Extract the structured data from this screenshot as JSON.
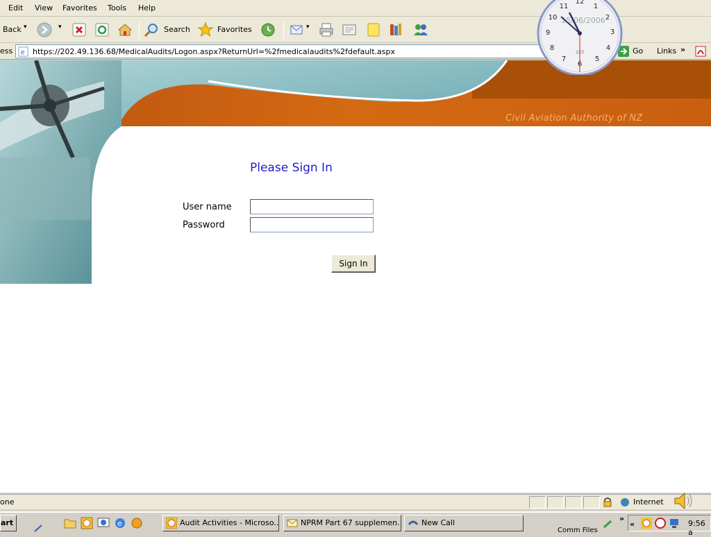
{
  "menu": {
    "items": [
      "Edit",
      "View",
      "Favorites",
      "Tools",
      "Help"
    ]
  },
  "toolbar": {
    "back_label": "Back",
    "search_label": "Search",
    "favorites_label": "Favorites"
  },
  "address": {
    "label": "ess",
    "url": "https://202.49.136.68/MedicalAudits/Logon.aspx?ReturnUrl=%2fmedicalaudits%2fdefault.aspx",
    "go_label": "Go",
    "links_label": "Links"
  },
  "clock_widget": {
    "date": "15/06/2006",
    "ampm": "AM"
  },
  "page": {
    "org_name": "Civil Aviation Authority of NZ",
    "title": "Please Sign In",
    "username_label": "User name",
    "username_value": "",
    "password_label": "Password",
    "password_value": "",
    "signin_label": "Sign In"
  },
  "status": {
    "text": "one",
    "zone": "Internet"
  },
  "taskbar": {
    "start_label": "art",
    "buttons": [
      {
        "label": "Audit Activities - Microso..."
      },
      {
        "label": "NPRM Part 67 supplemen..."
      },
      {
        "label": "New Call"
      }
    ],
    "comm_files": "Comm Files",
    "time": "9:56 a"
  },
  "colors": {
    "accent_orange": "#d2691e",
    "title_blue": "#2020c8",
    "teal": "#5a9aa0"
  }
}
